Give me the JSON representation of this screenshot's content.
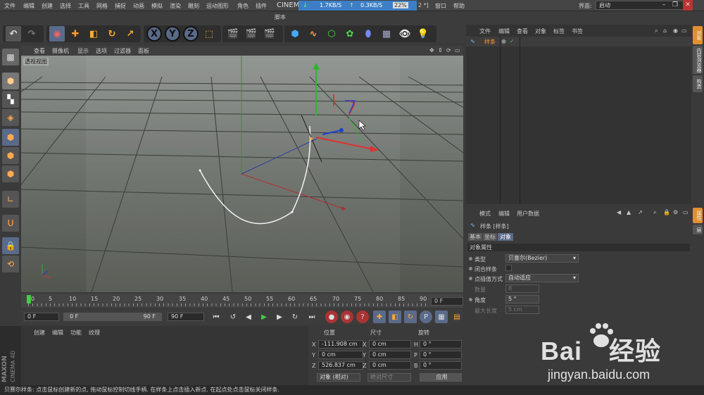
{
  "titlebar": {
    "title": "CINEM",
    "title_suffix": "2 *]",
    "net_down": "1.7KB/S",
    "net_up": "0.3KB/S",
    "cpu": "22%",
    "menus": [
      "文件",
      "编辑",
      "创建",
      "选择",
      "工具",
      "网格",
      "捕捉",
      "动画",
      "模拟",
      "渲染",
      "雕刻",
      "运动图形",
      "角色",
      "插件",
      "脚本",
      "窗口",
      "帮助"
    ],
    "layout_label": "界面:",
    "layout_value": "启动"
  },
  "viewport": {
    "menus": [
      "查看",
      "摄像机",
      "显示",
      "选项",
      "过滤器",
      "面板"
    ],
    "label": "透视视图"
  },
  "timeline": {
    "ticks": [
      "0",
      "5",
      "10",
      "15",
      "20",
      "25",
      "30",
      "35",
      "40",
      "45",
      "50",
      "55",
      "60",
      "65",
      "70",
      "75",
      "80",
      "85",
      "90"
    ],
    "end_field": "0 F"
  },
  "transport": {
    "current": "0 F",
    "start": "0 F",
    "range_end": "90 F",
    "end": "90 F"
  },
  "material": {
    "menus": [
      "创建",
      "编辑",
      "功能",
      "纹理"
    ]
  },
  "brand": {
    "line1": "MAXON",
    "line2": "CINEMA 4D"
  },
  "coords": {
    "headers": [
      "位置",
      "尺寸",
      "旋转"
    ],
    "rows": [
      {
        "axis": "X",
        "pos": "-111.908 cm",
        "size_axis": "X",
        "size": "0 cm",
        "rot_axis": "H",
        "rot": "0 °"
      },
      {
        "axis": "Y",
        "pos": "0 cm",
        "size_axis": "Y",
        "size": "0 cm",
        "rot_axis": "P",
        "rot": "0 °"
      },
      {
        "axis": "Z",
        "pos": "526.837 cm",
        "size_axis": "Z",
        "size": "0 cm",
        "rot_axis": "B",
        "rot": "0 °"
      }
    ],
    "mode": "对象 (相对)",
    "size_mode": "绝对尺寸",
    "apply": "应用"
  },
  "objmgr": {
    "menus": [
      "文件",
      "编辑",
      "查看",
      "对象",
      "标签",
      "书签"
    ],
    "object_name": "样条"
  },
  "attrmgr": {
    "menus": [
      "模式",
      "编辑",
      "用户数据"
    ],
    "object_title": "样条 [样条]",
    "tabs": [
      "基本",
      "坐标",
      "对象"
    ],
    "section": "对象属性",
    "props": {
      "type_label": "类型",
      "type_value": "贝塞尔(Bezier)",
      "close_label": "闭合样条",
      "interp_label": "点插值方式",
      "interp_value": "自动适应",
      "count_label": "数量",
      "count_value": "8",
      "angle_label": "角度",
      "angle_value": "5 °",
      "maxlen_label": "最大长度",
      "maxlen_value": "5 cm"
    }
  },
  "right_tabs": [
    "对象",
    "内容浏览器",
    "构造",
    "属性",
    "层"
  ],
  "statusbar": "贝赛尔样条: 点击鼠标创建新的点, 拖动鼠标控制切线手柄. 在样条上点击插入新点. 在起点处点击鼠标关闭样条.",
  "watermark": {
    "brand": "Bai",
    "brand2": "经验",
    "url": "jingyan.baidu.com"
  }
}
